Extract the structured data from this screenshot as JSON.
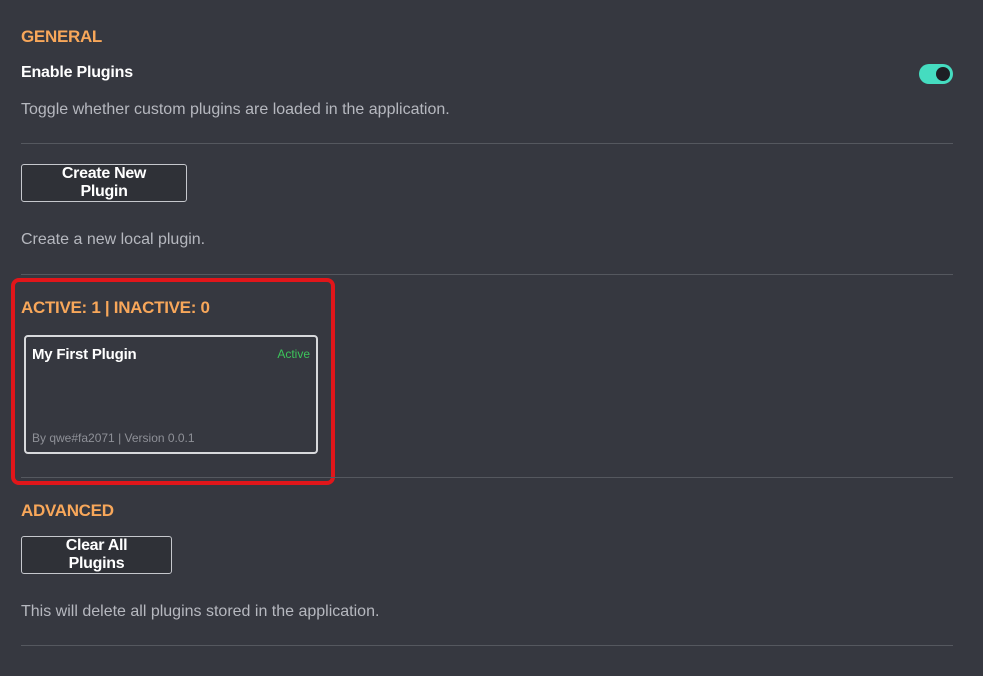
{
  "general": {
    "title": "GENERAL",
    "enable_plugins": {
      "label": "Enable Plugins",
      "description": "Toggle whether custom plugins are loaded in the application.",
      "enabled": true
    },
    "create": {
      "button_label": "Create New Plugin",
      "description": "Create a new local plugin."
    }
  },
  "plugins": {
    "summary": "ACTIVE: 1 | INACTIVE: 0",
    "items": [
      {
        "name": "My First Plugin",
        "status": "Active",
        "meta": "By qwe#fa2071 | Version 0.0.1"
      }
    ]
  },
  "advanced": {
    "title": "ADVANCED",
    "clear": {
      "button_label": "Clear All Plugins",
      "description": "This will delete all plugins stored in the application."
    }
  },
  "colors": {
    "background": "#363840",
    "accent_orange": "#f8a75a",
    "toggle_on": "#45dcc0",
    "active_green": "#3cc45a",
    "highlight_red": "#e1161a"
  }
}
